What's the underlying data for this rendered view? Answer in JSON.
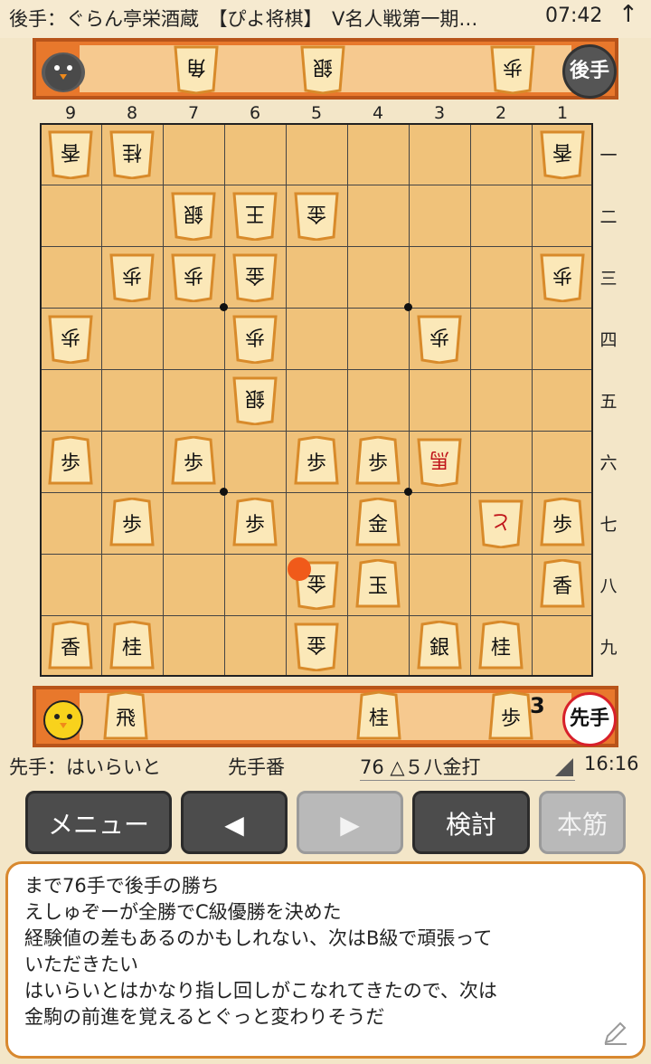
{
  "header": {
    "title": "後手：ぐらん亭栄酒蔵　【ぴよ将棋】　V名人戦第一期…",
    "clock": "07:42",
    "up_arrow": "↑"
  },
  "gote_stand": {
    "pieces": [
      "角",
      "銀",
      "歩"
    ],
    "badge": "後手",
    "avatar_icon": "gote-chick-icon"
  },
  "sente_stand": {
    "pieces": [
      "飛",
      "桂",
      "歩"
    ],
    "pawn_count": "3",
    "badge": "先手",
    "avatar_icon": "sente-chick-icon"
  },
  "board": {
    "file_labels": [
      "9",
      "8",
      "7",
      "6",
      "5",
      "4",
      "3",
      "2",
      "1"
    ],
    "rank_labels": [
      "一",
      "二",
      "三",
      "四",
      "五",
      "六",
      "七",
      "八",
      "九"
    ],
    "last_move_square": "5八",
    "pieces": [
      {
        "sq": "9一",
        "p": "香",
        "side": "gote"
      },
      {
        "sq": "8一",
        "p": "桂",
        "side": "gote"
      },
      {
        "sq": "1一",
        "p": "香",
        "side": "gote"
      },
      {
        "sq": "7二",
        "p": "銀",
        "side": "gote"
      },
      {
        "sq": "6二",
        "p": "王",
        "side": "gote"
      },
      {
        "sq": "5二",
        "p": "金",
        "side": "gote"
      },
      {
        "sq": "8三",
        "p": "歩",
        "side": "gote"
      },
      {
        "sq": "7三",
        "p": "歩",
        "side": "gote"
      },
      {
        "sq": "6三",
        "p": "金",
        "side": "gote"
      },
      {
        "sq": "1三",
        "p": "歩",
        "side": "gote"
      },
      {
        "sq": "9四",
        "p": "歩",
        "side": "gote"
      },
      {
        "sq": "6四",
        "p": "歩",
        "side": "gote"
      },
      {
        "sq": "3四",
        "p": "歩",
        "side": "gote"
      },
      {
        "sq": "6五",
        "p": "銀",
        "side": "gote"
      },
      {
        "sq": "9六",
        "p": "歩",
        "side": "sente"
      },
      {
        "sq": "7六",
        "p": "歩",
        "side": "sente"
      },
      {
        "sq": "5六",
        "p": "歩",
        "side": "sente"
      },
      {
        "sq": "4六",
        "p": "歩",
        "side": "sente"
      },
      {
        "sq": "3六",
        "p": "馬",
        "side": "gote",
        "promoted": true
      },
      {
        "sq": "8七",
        "p": "歩",
        "side": "sente"
      },
      {
        "sq": "6七",
        "p": "歩",
        "side": "sente"
      },
      {
        "sq": "4七",
        "p": "金",
        "side": "sente"
      },
      {
        "sq": "2七",
        "p": "と",
        "side": "gote",
        "promoted": true
      },
      {
        "sq": "1七",
        "p": "歩",
        "side": "sente"
      },
      {
        "sq": "5八",
        "p": "金",
        "side": "gote"
      },
      {
        "sq": "4八",
        "p": "玉",
        "side": "sente"
      },
      {
        "sq": "1八",
        "p": "香",
        "side": "sente"
      },
      {
        "sq": "9九",
        "p": "香",
        "side": "sente"
      },
      {
        "sq": "8九",
        "p": "桂",
        "side": "sente"
      },
      {
        "sq": "5九",
        "p": "金",
        "side": "gote"
      },
      {
        "sq": "3九",
        "p": "銀",
        "side": "sente"
      },
      {
        "sq": "2九",
        "p": "桂",
        "side": "sente"
      }
    ]
  },
  "status_bar": {
    "player": "先手：はいらいと",
    "turn": "先手番",
    "move": "76 △５八金打",
    "elapsed": "16:16"
  },
  "controls": {
    "menu": "メニュー",
    "prev": "◀",
    "next": "▶",
    "analyze": "検討",
    "main_line": "本筋"
  },
  "comment": {
    "lines": [
      "まで76手で後手の勝ち",
      "えしゅぞーが全勝でC級優勝を決めた",
      "経験値の差もあるのかもしれない、次はB級で頑張って",
      "いただきたい",
      "はいらいとはかなり指し回しがこなれてきたので、次は",
      "金駒の前進を覚えるとぐっと変わりそうだ"
    ],
    "edit_icon": "pencil-icon"
  }
}
